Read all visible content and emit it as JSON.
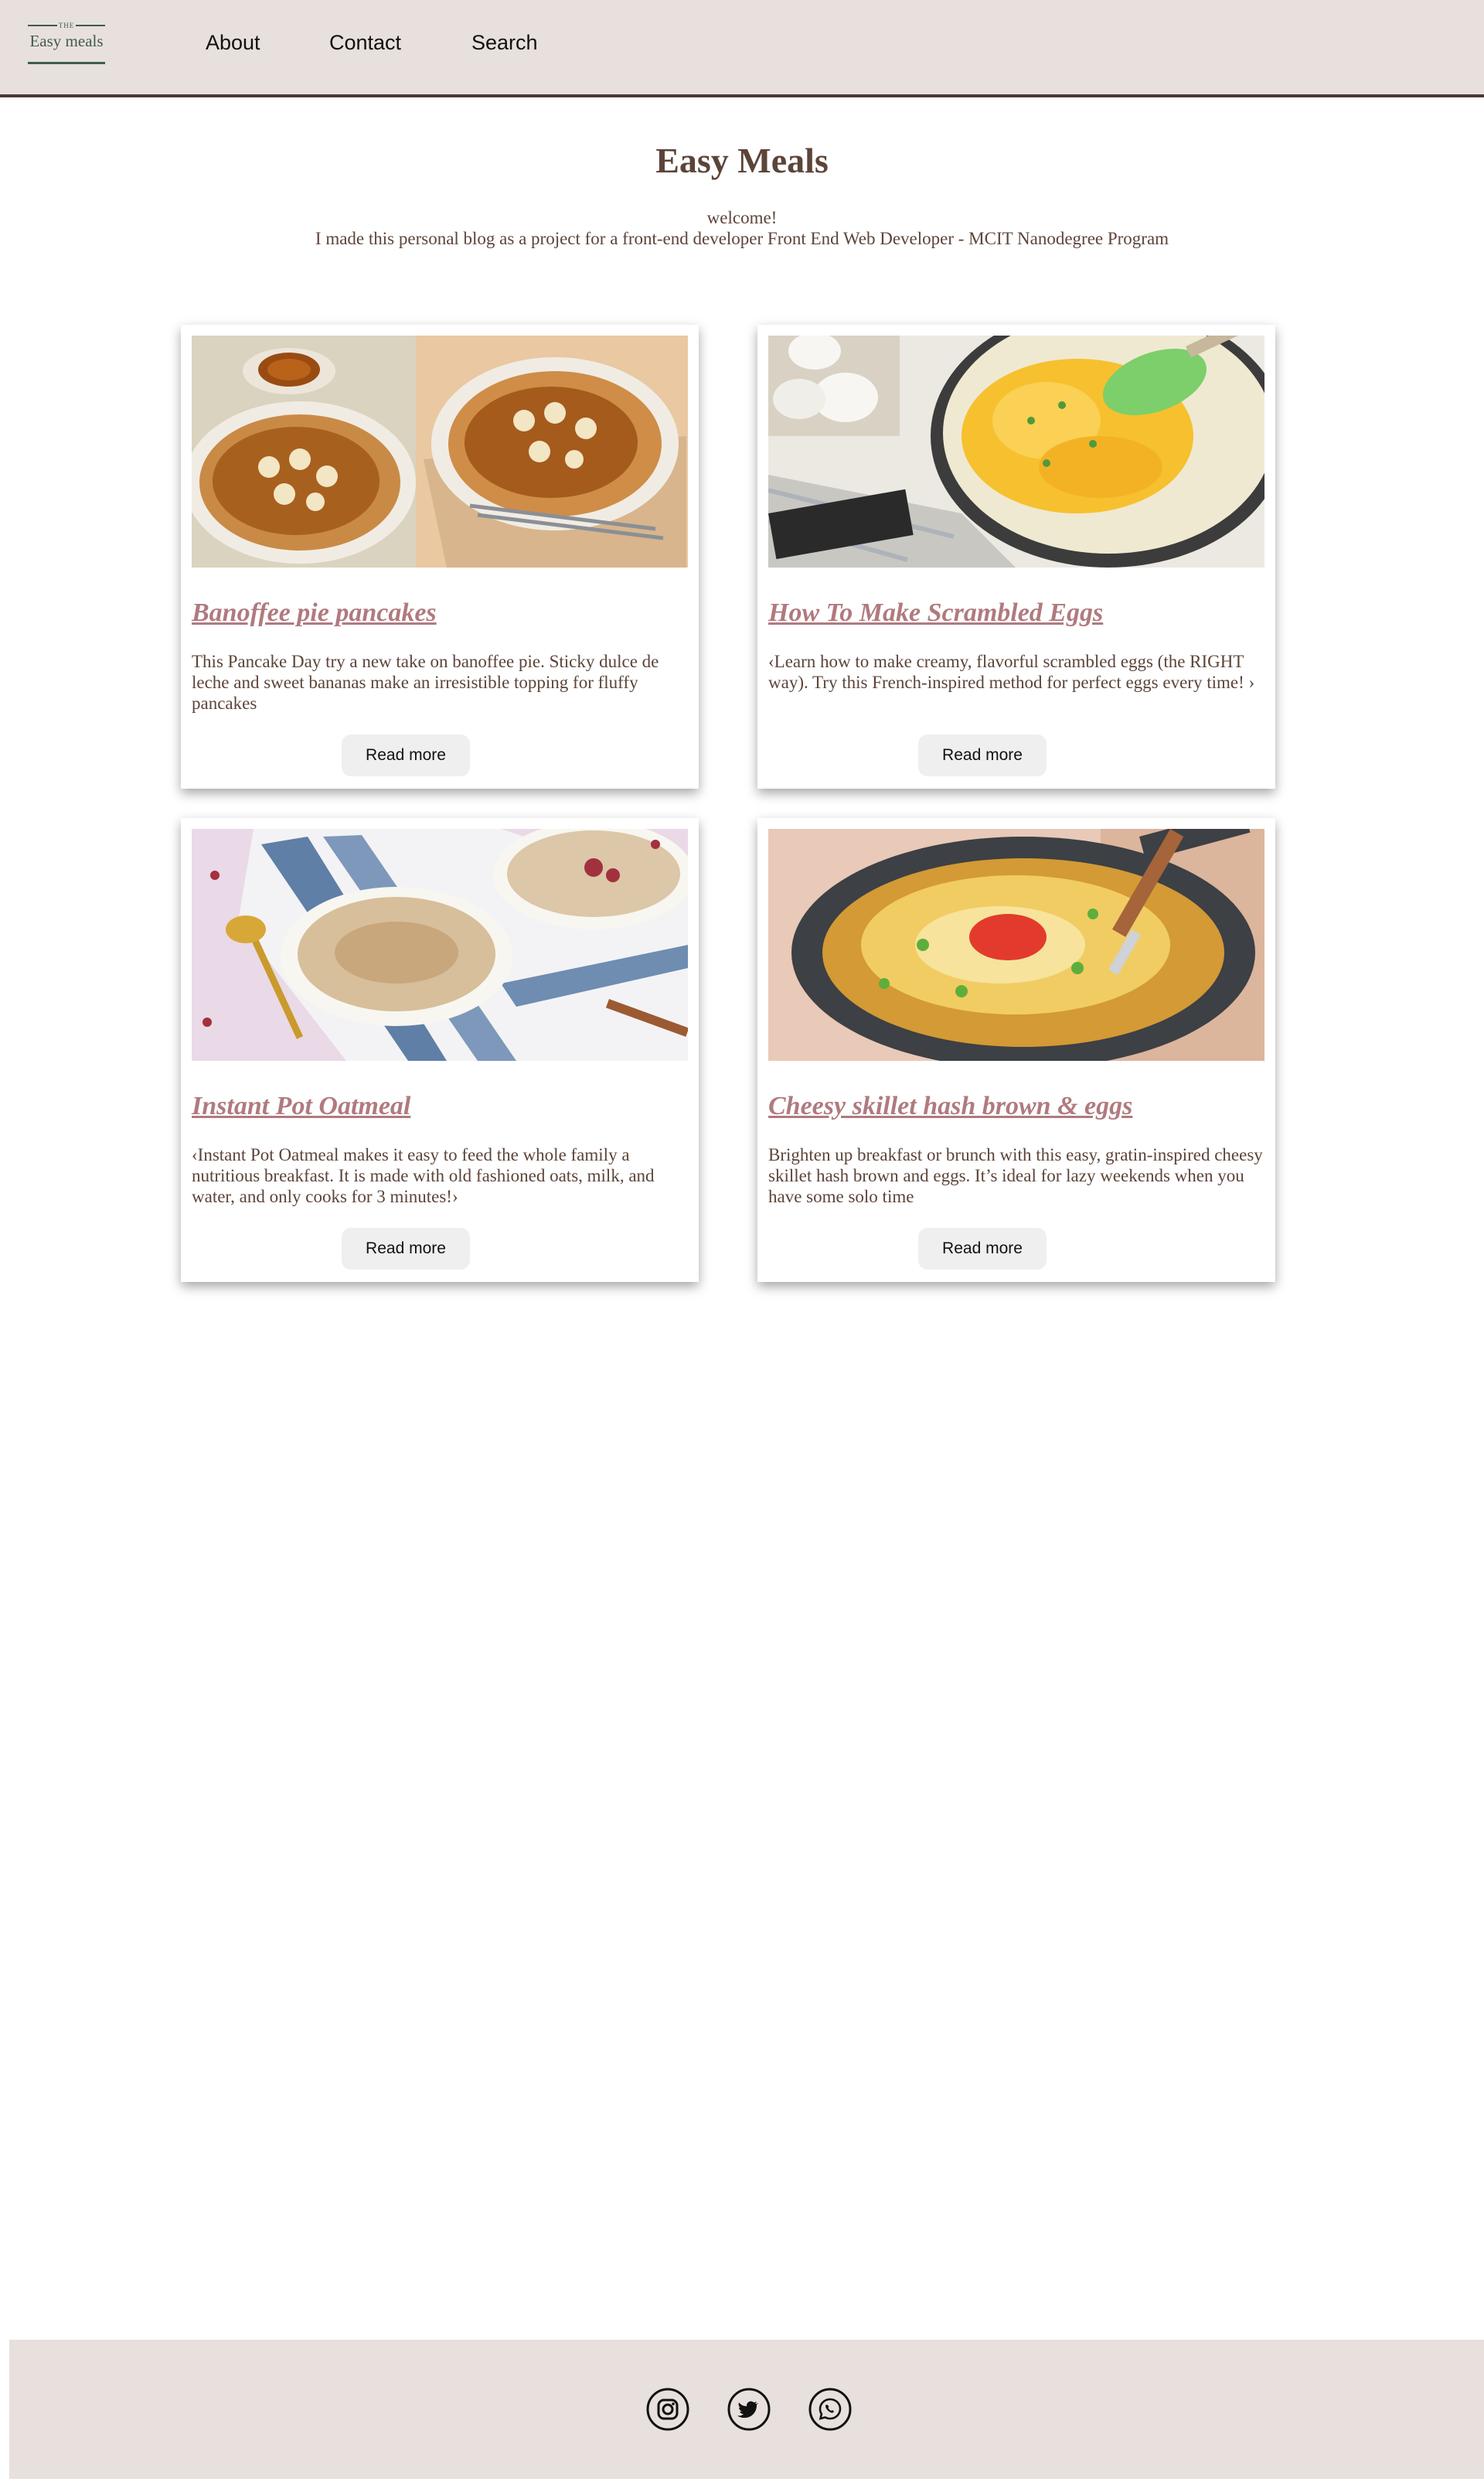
{
  "header": {
    "logo": {
      "small_text": "THE",
      "name": "Easy meals"
    },
    "nav": [
      "About",
      "Contact",
      "Search"
    ]
  },
  "hero": {
    "title": "Easy Meals",
    "welcome": "welcome!",
    "description": "I made this personal blog as a project for a front-end developer Front End Web Developer - MCIT Nanodegree Program"
  },
  "cards": [
    {
      "title": "Banoffee pie pancakes",
      "text": "This Pancake Day try a new take on banoffee pie. Sticky dulce de leche and sweet bananas make an irresistible topping for fluffy pancakes",
      "button": "Read more",
      "image": "banoffee-pancakes-photo"
    },
    {
      "title": "How To Make Scrambled Eggs",
      "text": "‹Learn how to make creamy, flavorful scrambled eggs (the RIGHT way). Try this French-inspired method for perfect eggs every time! ›",
      "button": "Read more",
      "image": "scrambled-eggs-photo"
    },
    {
      "title": "Instant Pot Oatmeal",
      "text": "‹Instant Pot Oatmeal makes it easy to feed the whole family a nutritious breakfast. It is made with old fashioned oats, milk, and water, and only cooks for 3 minutes!›",
      "button": "Read more",
      "image": "oatmeal-photo"
    },
    {
      "title": "Cheesy skillet hash brown & eggs",
      "text": "Brighten up breakfast or brunch with this easy, gratin-inspired cheesy skillet hash brown and eggs. It’s ideal for lazy weekends when you have some solo time",
      "button": "Read more",
      "image": "hash-brown-skillet-photo"
    }
  ],
  "footer": {
    "social_icons": [
      "instagram-icon",
      "twitter-icon",
      "whatsapp-icon"
    ]
  },
  "colors": {
    "header_bg": "#e8e0dc",
    "text": "#5c4439",
    "card_title": "#b07a7e",
    "logo": "#3f5c4e"
  }
}
